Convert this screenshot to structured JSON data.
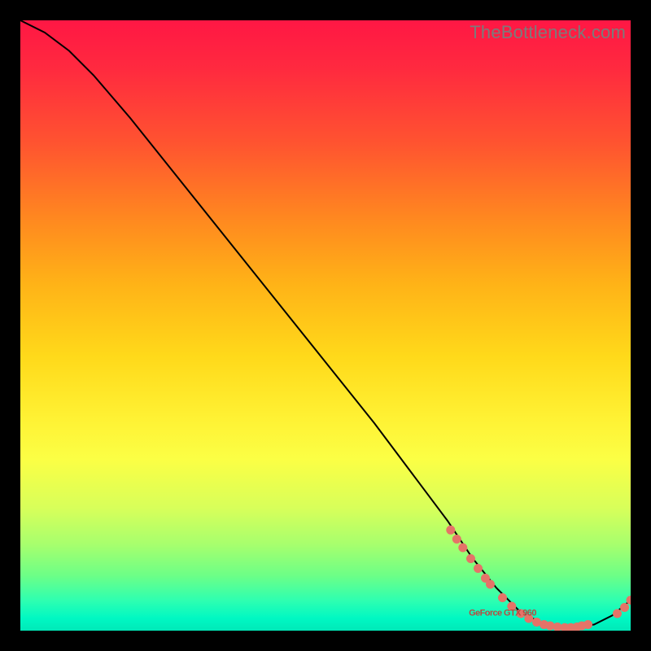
{
  "watermark": "TheBottleneck.com",
  "annotation_label": "GeForce GTX 960",
  "chart_data": {
    "type": "line",
    "title": "",
    "xlabel": "",
    "ylabel": "",
    "xlim": [
      0,
      100
    ],
    "ylim": [
      0,
      100
    ],
    "series": [
      {
        "name": "bottleneck-curve",
        "x": [
          0,
          4,
          8,
          12,
          18,
          26,
          34,
          42,
          50,
          58,
          64,
          70,
          74,
          78,
          82,
          86,
          90,
          94,
          97,
          100
        ],
        "y": [
          100,
          98,
          95,
          91,
          84,
          74,
          64,
          54,
          44,
          34,
          26,
          18,
          12,
          7,
          3,
          1,
          0.5,
          1,
          2.5,
          5
        ]
      }
    ],
    "markers": {
      "name": "gpu-points",
      "x": [
        70.5,
        71.5,
        72.5,
        73.8,
        75.0,
        76.2,
        77.0,
        79.0,
        80.5,
        82.0,
        83.3,
        84.6,
        85.8,
        86.8,
        88.0,
        89.2,
        90.2,
        91.2,
        92.0,
        93.0,
        97.8,
        99.0,
        100.0
      ],
      "y": [
        16.5,
        15.0,
        13.6,
        11.8,
        10.2,
        8.6,
        7.6,
        5.4,
        4.0,
        2.8,
        2.0,
        1.4,
        1.0,
        0.8,
        0.6,
        0.5,
        0.5,
        0.6,
        0.8,
        1.0,
        2.8,
        3.8,
        5.0
      ]
    },
    "annotation": {
      "x": 79,
      "y": 2.5
    }
  },
  "colors": {
    "dot": "#e57368",
    "curve": "#000000",
    "anno": "#b64c42"
  }
}
